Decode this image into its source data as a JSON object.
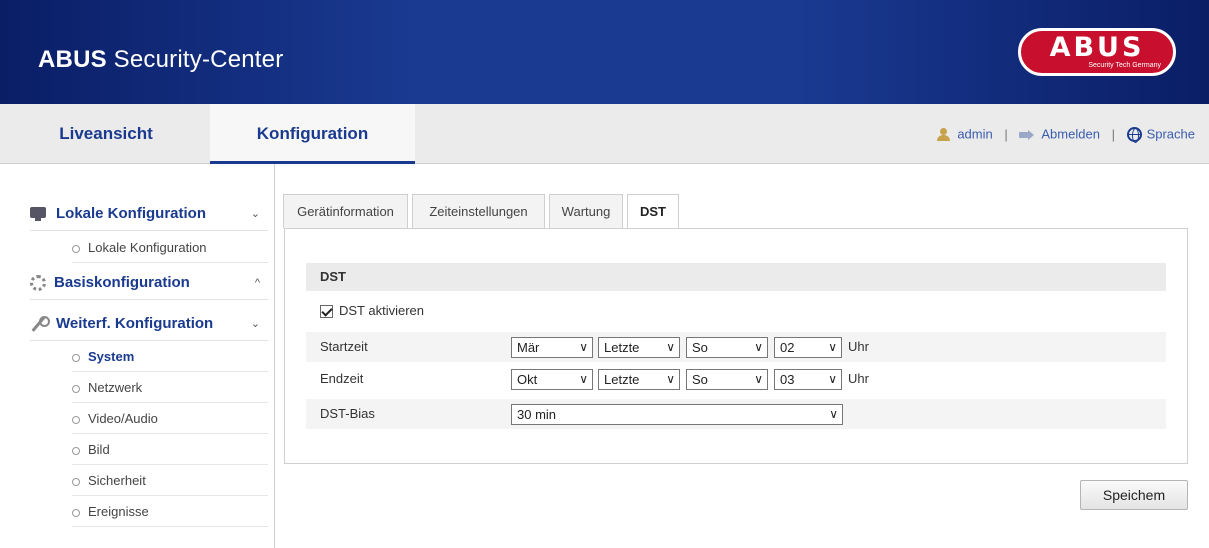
{
  "header": {
    "title_bold": "ABUS",
    "title_rest": " Security-Center",
    "logo_brand": "ABUS",
    "logo_tagline": "Security Tech Germany"
  },
  "topnav": {
    "tabs": [
      {
        "label": "Liveansicht"
      },
      {
        "label": "Konfiguration"
      }
    ],
    "user": "admin",
    "logout": "Abmelden",
    "language": "Sprache",
    "separator": "|"
  },
  "sidebar": {
    "groups": [
      {
        "label": "Lokale Konfiguration",
        "chevron": "⌄",
        "icon": "monitor-icon"
      },
      {
        "label": "Basiskonfiguration",
        "chevron": "^",
        "icon": "gear-icon"
      },
      {
        "label": "Weiterf. Konfiguration",
        "chevron": "⌄",
        "icon": "wrench-icon"
      }
    ],
    "items": [
      {
        "label": "Lokale Konfiguration"
      },
      {
        "label": "System"
      },
      {
        "label": "Netzwerk"
      },
      {
        "label": "Video/Audio"
      },
      {
        "label": "Bild"
      },
      {
        "label": "Sicherheit"
      },
      {
        "label": "Ereignisse"
      }
    ]
  },
  "tabs": [
    {
      "label": "Gerätinformation"
    },
    {
      "label": "Zeiteinstellungen"
    },
    {
      "label": "Wartung"
    },
    {
      "label": "DST"
    }
  ],
  "dst": {
    "section_title": "DST",
    "enable_label": "DST aktivieren",
    "start": {
      "label": "Startzeit",
      "month": "Mär",
      "week": "Letzte",
      "day": "So",
      "hour": "02",
      "unit": "Uhr"
    },
    "end": {
      "label": "Endzeit",
      "month": "Okt",
      "week": "Letzte",
      "day": "So",
      "hour": "03",
      "unit": "Uhr"
    },
    "bias": {
      "label": "DST-Bias",
      "value": "30 min"
    }
  },
  "save_label": "Speichem",
  "colors": {
    "header_blue": "#1a3a92",
    "link_blue": "#1a3a8f",
    "logo_red": "#c8102e"
  }
}
